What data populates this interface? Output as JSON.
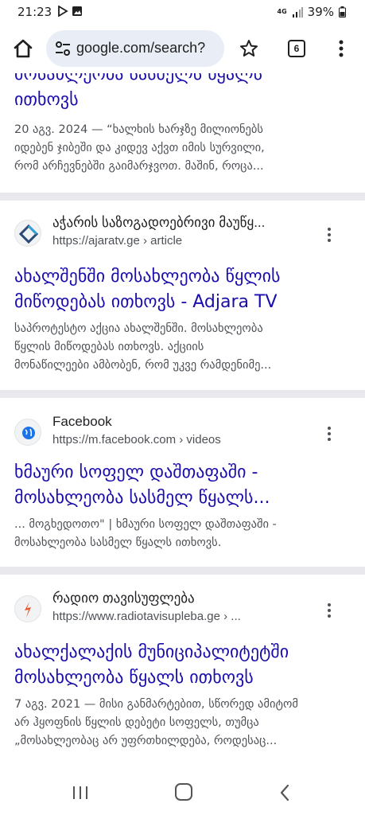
{
  "status_bar": {
    "time": "21:23",
    "network": "4G",
    "battery": "39%"
  },
  "browser": {
    "url": "google.com/search?",
    "tab_count": "6"
  },
  "results": [
    {
      "title": "მოსახლეობა სასმელს წყალს ითხოვს",
      "title_lines": [
        "მოსახლეობა სასმელს წყალს",
        "ითხოვს"
      ],
      "snippet_lines": [
        "20 აგვ. 2024 — “ხალხის ხარჯზე მილიონებს",
        "იდებენ ჯიბეში და კიდევ აქვთ იმის სურვილი,",
        "რომ არჩევნებში გაიმარჯვოთ. მაშინ, როცა..."
      ]
    },
    {
      "site_name": "აჭარის საზოგადოებრივი მაუწყ...",
      "site_url": "https://ajaratv.ge › article",
      "favicon": "ajara-tv-diamond-icon",
      "title_lines": [
        "ახალშენში მოსახლეობა წყლის",
        "მიწოდებას ითხოვს - Adjara TV"
      ],
      "snippet_lines": [
        "საპროტესტო აქცია ახალშენში. მოსახლეობა",
        "წყლის მიწოდებას ითხოვს. აქციის",
        "მონაწილეები ამბობენ, რომ უკვე რამდენიმე..."
      ]
    },
    {
      "site_name": "Facebook",
      "site_url": "https://m.facebook.com › videos",
      "favicon": "globe-icon",
      "title_lines": [
        "ხმაური სოფელ დაშთაფაში -",
        "მოსახლეობა სასმელ წყალს..."
      ],
      "snippet_lines": [
        "... მოგხედოთო\" | ხმაური სოფელ დაშთაფაში -",
        "მოსახლეობა სასმელ წყალს ითხოვს."
      ]
    },
    {
      "site_name": "რადიო თავისუფლება",
      "site_url": "https://www.radiotavisupleba.ge › ...",
      "favicon": "radio-liberty-flame-icon",
      "title_lines": [
        "ახალქალაქის მუნიციპალიტეტში",
        "მოსახლეობა წყალს ითხოვს"
      ],
      "snippet_lines": [
        "7 აგვ. 2021 — მისი განმარტებით, სწორედ ამიტომ",
        "არ ჰყოფნის წყლის დებეტი სოფელს, თუმცა",
        "„მოსახლეობაც არ უფრთხილდება, როდესაც..."
      ]
    }
  ],
  "colors": {
    "link": "#1a0dab",
    "snippet": "#4d5156",
    "divider": "#e8e8ed",
    "url_bar": "#e9eef6"
  }
}
